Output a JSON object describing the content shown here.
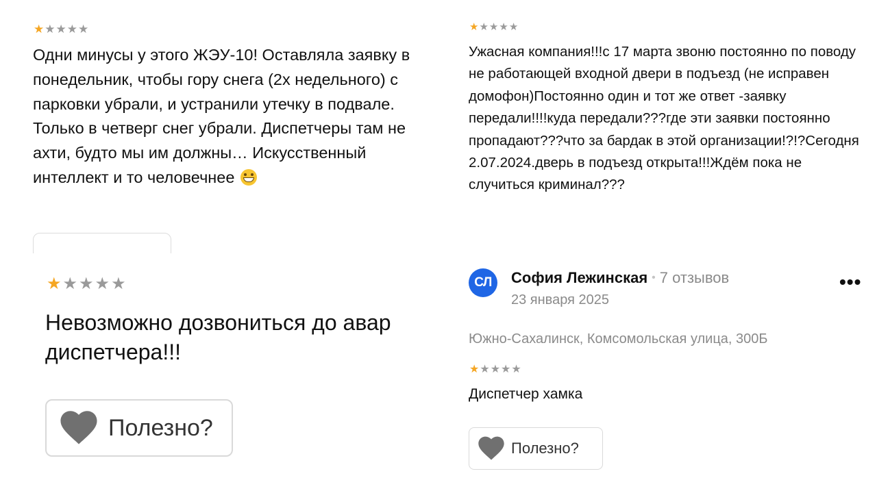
{
  "reviews": [
    {
      "rating": 1,
      "max_rating": 5,
      "text": "Одни минусы у этого ЖЭУ-10! Оставляла заявку в понедельник, чтобы гору снега (2х недельного) с парковки убрали, и устранили утечку в подвале. Только в четверг снег убрали. Диспетчеры там не ахти, будто мы им должны… Искусственный интеллект и то человечнее",
      "emoji": "grinning-face-emoji"
    },
    {
      "rating": 1,
      "max_rating": 5,
      "text": "Ужасная компания!!!с 17 марта звоню постоянно по поводу не работающей входной двери в подъезд (не исправен домофон)Постоянно один и тот же ответ -заявку передали!!!!куда передали???где эти заявки постоянно пропадают???что за бардак в этой организации!?!?Сегодня 2.07.2024.дверь в подъезд открыта!!!Ждём пока не случиться криминал???"
    },
    {
      "rating": 1,
      "max_rating": 5,
      "text": "Невозможно дозвониться до авар\nдиспетчера!!!",
      "helpful_label": "Полезно?"
    },
    {
      "author_initials": "СЛ",
      "author_name": "София Лежинская",
      "author_reviews": "7 отзывов",
      "date": "23 января 2025",
      "address": "Южно-Сахалинск, Комсомольская улица, 300Б",
      "rating": 1,
      "max_rating": 5,
      "text": "Диспетчер хамка",
      "helpful_label": "Полезно?",
      "more_label": "•••"
    }
  ],
  "colors": {
    "star_active": "#f5a623",
    "star_inactive": "#9a9a9a",
    "avatar_bg": "#1f66e5",
    "heart": "#707070"
  }
}
